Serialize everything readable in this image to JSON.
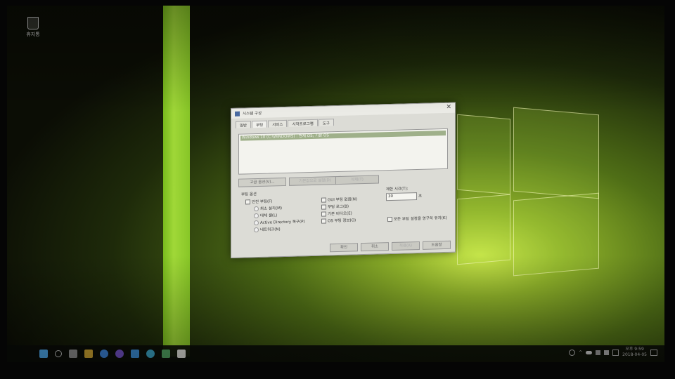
{
  "desktop": {
    "recycle_bin_label": "휴지통"
  },
  "dialog": {
    "title": "시스템 구성",
    "close": "✕",
    "tabs": [
      "일반",
      "부팅",
      "서비스",
      "시작프로그램",
      "도구"
    ],
    "boot_entry": "Windows 10 (C:\\WINDOWS) : 현재 OS; 기본 OS",
    "buttons": {
      "advanced": "고급 옵션(V)...",
      "set_default": "기본값으로 설정(D)",
      "delete": "삭제(T)",
      "ok": "확인",
      "cancel": "취소",
      "apply": "적용(A)",
      "help": "도움말"
    },
    "boot_options_header": "부팅 옵션",
    "safe_boot": "안전 부팅(F)",
    "radios": [
      "최소 설치(M)",
      "대체 셸(L)",
      "Active Directory 복구(P)",
      "네트워크(N)"
    ],
    "checkboxes": [
      "GUI 부팅 없음(N)",
      "부팅 로그(B)",
      "기본 비디오(E)",
      "OS 부팅 정보(O)"
    ],
    "timeout_label": "제한 시간(T):",
    "timeout_value": "30",
    "timeout_unit": "초",
    "permanent": "모든 부팅 설정을 영구히 유지(K)"
  },
  "tray": {
    "ampm": "오후",
    "time": "9:59",
    "date": "2018-04-05"
  },
  "colors": {
    "glitch": "#8ccd28",
    "selection": "#9fb08a"
  }
}
